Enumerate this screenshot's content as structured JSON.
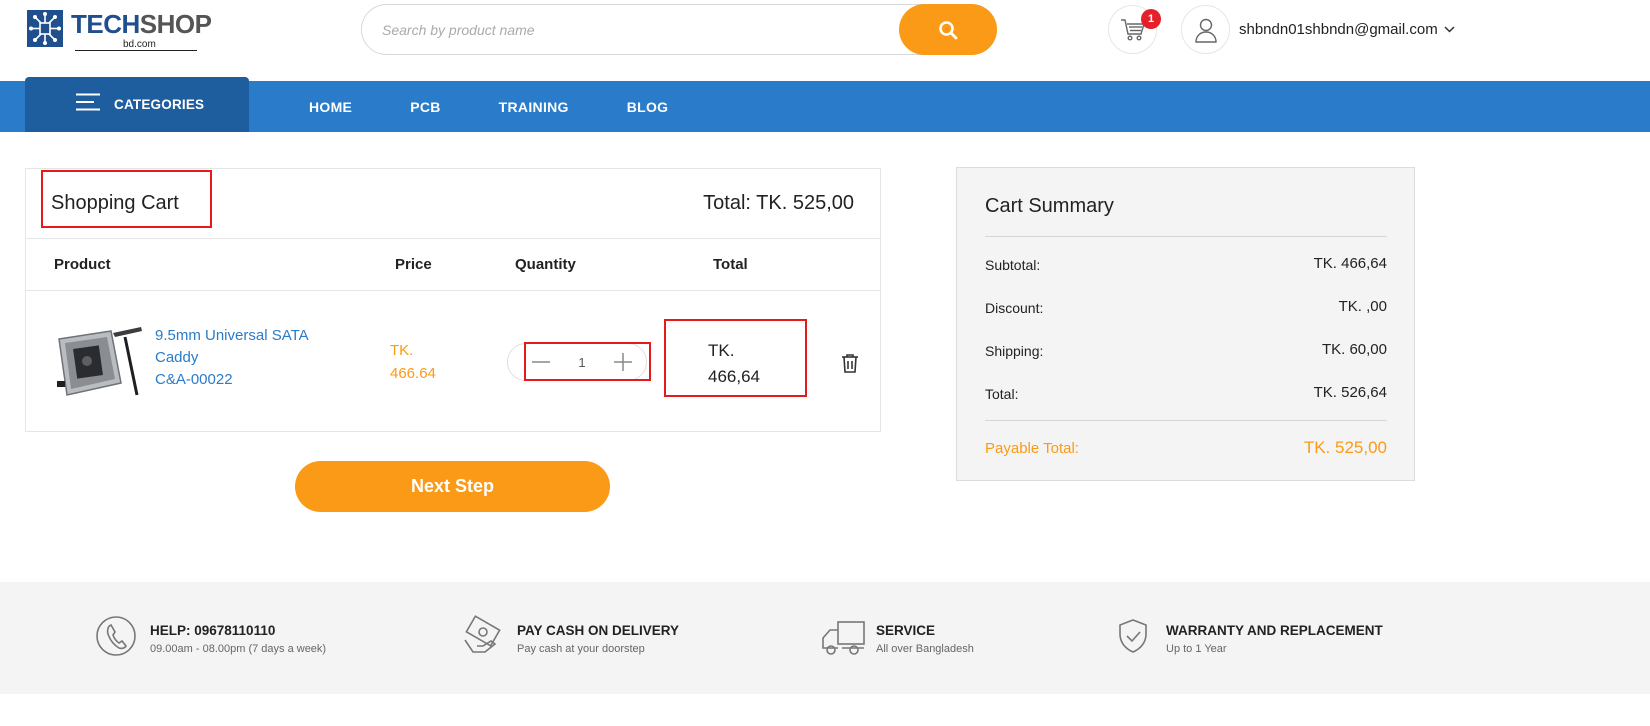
{
  "header": {
    "logo": {
      "text_primary": "TECH",
      "text_secondary": "SHOP",
      "subtext": "bd.com"
    },
    "search": {
      "placeholder": "Search by product name"
    },
    "cart": {
      "count": "1"
    },
    "user": {
      "email": "shbndn01shbndn@gmail.com"
    }
  },
  "nav": {
    "categories_label": "CATEGORIES",
    "links": [
      "HOME",
      "PCB",
      "TRAINING",
      "BLOG"
    ]
  },
  "cart": {
    "title": "Shopping Cart",
    "total": "Total: TK. 525,00",
    "columns": [
      "Product",
      "Price",
      "Quantity",
      "Total"
    ],
    "items": [
      {
        "name_line1": "9.5mm Universal SATA",
        "name_line2": "Caddy",
        "sku": "C&A-00022",
        "price_line1": "TK.",
        "price_line2": "466.64",
        "quantity": "1",
        "total_line1": "TK.",
        "total_line2": "466,64"
      }
    ],
    "next_button": "Next Step"
  },
  "summary": {
    "title": "Cart Summary",
    "rows": [
      {
        "label": "Subtotal:",
        "value": "TK. 466,64"
      },
      {
        "label": "Discount:",
        "value": "TK. ,00"
      },
      {
        "label": "Shipping:",
        "value": "TK. 60,00"
      },
      {
        "label": "Total:",
        "value": "TK. 526,64"
      }
    ],
    "payable_label": "Payable Total:",
    "payable_value": "TK. 525,00"
  },
  "features": [
    {
      "icon": "phone-icon",
      "title": "HELP: 09678110110",
      "subtitle": "09.00am - 08.00pm (7 days a week)"
    },
    {
      "icon": "cash-icon",
      "title": "PAY CASH ON DELIVERY",
      "subtitle": "Pay cash at your doorstep"
    },
    {
      "icon": "truck-icon",
      "title": "SERVICE",
      "subtitle": "All over Bangladesh"
    },
    {
      "icon": "shield-check-icon",
      "title": "WARRANTY AND REPLACEMENT",
      "subtitle": "Up to 1 Year"
    }
  ],
  "colors": {
    "brand_blue": "#2a7bc9",
    "nav_dark_blue": "#1e5e9f",
    "accent_orange": "#fb9a16",
    "highlight_red": "#e31b1b",
    "badge_red": "#e5202b"
  }
}
